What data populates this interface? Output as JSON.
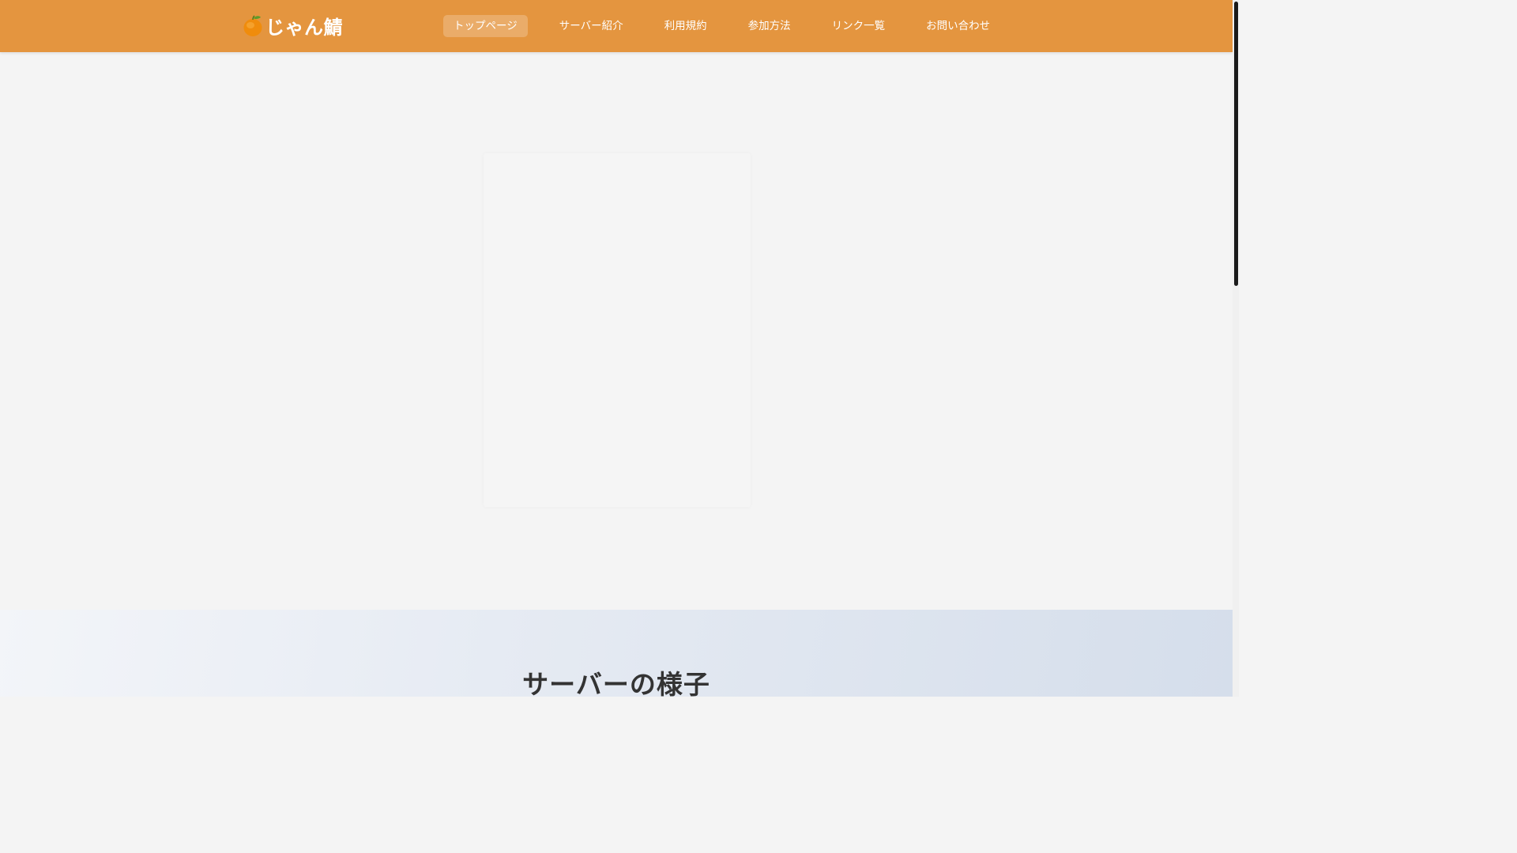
{
  "header": {
    "logo": {
      "icon": "tangerine-icon",
      "text": "じゃん鯖"
    },
    "nav": [
      {
        "label": "トップページ",
        "active": true
      },
      {
        "label": "サーバー紹介",
        "active": false
      },
      {
        "label": "利用規約",
        "active": false
      },
      {
        "label": "参加方法",
        "active": false
      },
      {
        "label": "リンク一覧",
        "active": false
      },
      {
        "label": "お問い合わせ",
        "active": false
      }
    ]
  },
  "gallery": {
    "title": "サーバーの様子"
  },
  "colors": {
    "header_bg": "#e4953f",
    "page_bg": "#f4f4f4",
    "title_text": "#333333"
  }
}
